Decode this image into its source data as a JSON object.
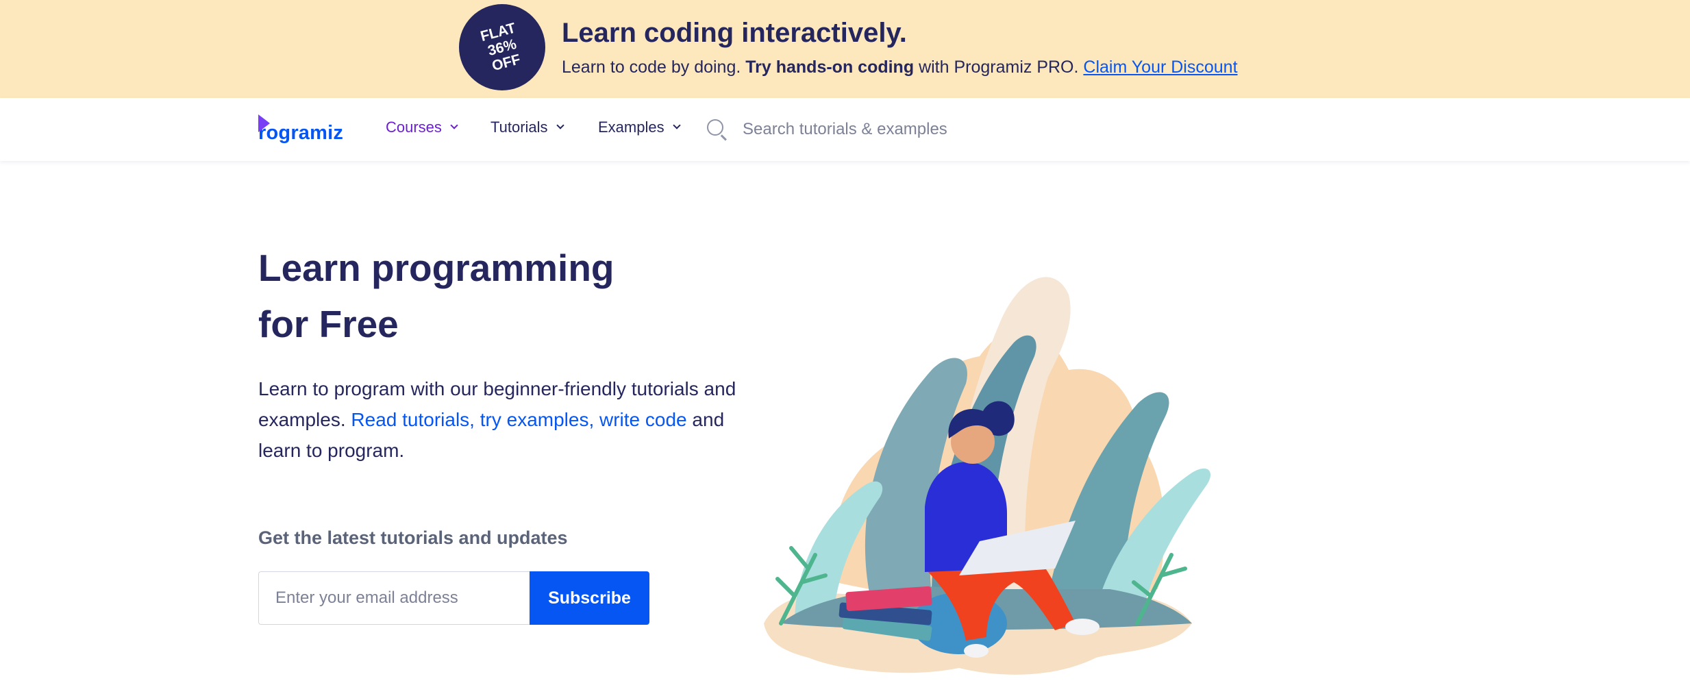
{
  "banner": {
    "badge_text": "FLAT\n36%\nOFF",
    "title": "Learn coding interactively.",
    "subtitle_lead": "Learn to code by doing.",
    "subtitle_bold": "Try hands-on coding",
    "subtitle_mid": "with Programiz PRO.",
    "cta_link": "Claim Your Discount",
    "bg_color": "#fde8bd"
  },
  "navbar": {
    "logo_text": "rogramiz",
    "logo_icon": "programiz-logo-icon",
    "items": [
      {
        "label": "Courses",
        "active": true
      },
      {
        "label": "Tutorials",
        "active": false
      },
      {
        "label": "Examples",
        "active": false
      }
    ],
    "search": {
      "placeholder": "Search tutorials & examples",
      "value": ""
    }
  },
  "hero": {
    "title_line1": "Learn programming",
    "title_line2": "for Free",
    "desc_lead": "Learn to program with our beginner-friendly tutorials and examples.",
    "desc_link1": "Read tutorials,",
    "desc_link2": "try examples,",
    "desc_link3": "write code",
    "desc_tail": "and learn to program.",
    "newsletter_title": "Get the latest tutorials and updates",
    "email_placeholder": "Enter your email address",
    "subscribe_label": "Subscribe"
  },
  "colors": {
    "primary": "#0556f3",
    "navy": "#25265e",
    "active_nav": "#6b1fd1"
  }
}
